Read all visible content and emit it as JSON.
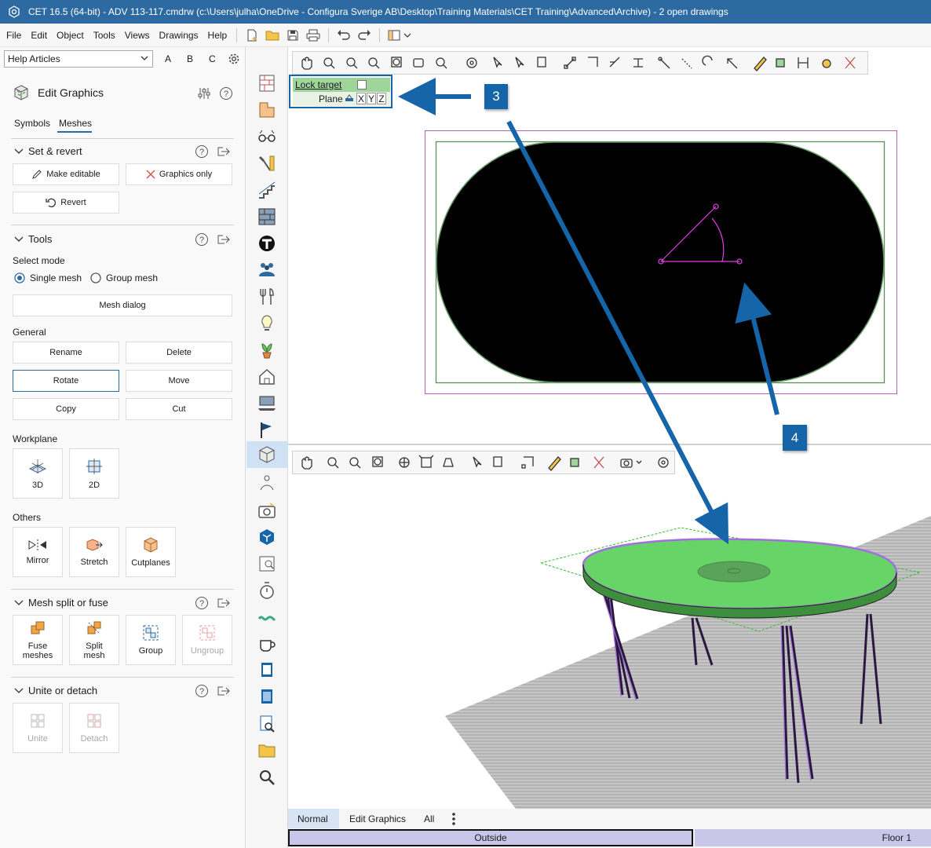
{
  "window": {
    "title": "CET 16.5 (64-bit) - ADV 113-117.cmdrw (c:\\Users\\julha\\OneDrive - Configura Sverige AB\\Desktop\\Training Materials\\CET Training\\Advanced\\Archive) - 2  open drawings"
  },
  "menu": [
    "File",
    "Edit",
    "Object",
    "Tools",
    "Views",
    "Drawings",
    "Help"
  ],
  "help": {
    "selected": "Help Articles",
    "letters": [
      "A",
      "B",
      "C"
    ]
  },
  "panel": {
    "title": "Edit Graphics",
    "tabs": [
      "Symbols",
      "Meshes"
    ],
    "active_tab": "Meshes",
    "set_revert": {
      "title": "Set & revert",
      "make_editable": "Make editable",
      "graphics_only": "Graphics only",
      "revert": "Revert"
    },
    "tools": {
      "title": "Tools",
      "select_mode_label": "Select mode",
      "single_mesh": "Single mesh",
      "group_mesh": "Group mesh",
      "mesh_dialog": "Mesh dialog",
      "general_label": "General",
      "rename": "Rename",
      "delete": "Delete",
      "rotate": "Rotate",
      "move": "Move",
      "copy": "Copy",
      "cut": "Cut",
      "workplane_label": "Workplane",
      "wp_3d": "3D",
      "wp_2d": "2D",
      "others_label": "Others",
      "mirror": "Mirror",
      "stretch": "Stretch",
      "cutplanes": "Cutplanes"
    },
    "split": {
      "title": "Mesh split or fuse",
      "fuse1": "Fuse",
      "fuse2": "meshes",
      "split1": "Split",
      "split2": "mesh",
      "group": "Group",
      "ungroup": "Ungroup"
    },
    "unite": {
      "title": "Unite or detach",
      "unite": "Unite",
      "detach": "Detach"
    }
  },
  "lock": {
    "label": "Lock target",
    "plane": "Plane",
    "axes": [
      "X",
      "Y",
      "Z"
    ]
  },
  "callouts": {
    "c3": "3",
    "c4": "4"
  },
  "statusbar": {
    "tabs": [
      "Normal",
      "Edit Graphics",
      "All"
    ],
    "space": "Outside",
    "floor": "Floor 1"
  },
  "colors": {
    "accent": "#2d6aa1",
    "callout": "#1565a8",
    "table_top": "#66d466",
    "tag_green": "#9fd49a"
  }
}
